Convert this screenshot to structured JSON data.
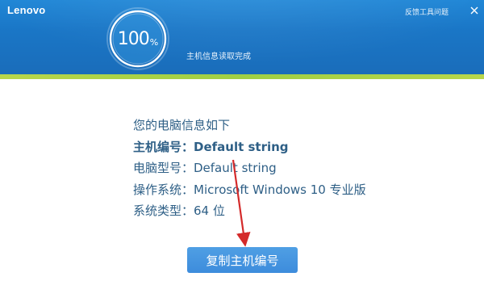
{
  "header": {
    "logo": "Lenovo",
    "feedback_label": "反馈工具问题",
    "close_icon": "close-icon",
    "progress_value": "100",
    "progress_unit": "%",
    "progress_fraction": 1.0,
    "status": "主机信息读取完成"
  },
  "info": {
    "intro": "您的电脑信息如下",
    "host_id": "主机编号：Default string",
    "model": "电脑型号：Default string",
    "os": "操作系统：Microsoft Windows 10 专业版",
    "sys_type": "系统类型：64 位"
  },
  "actions": {
    "copy_label": "复制主机编号"
  },
  "colors": {
    "header_blue": "#1a76c6",
    "accent_green": "#a6d046",
    "text_blue": "#2e5f86",
    "button_blue": "#4396df",
    "arrow_red": "#d42a2a"
  }
}
